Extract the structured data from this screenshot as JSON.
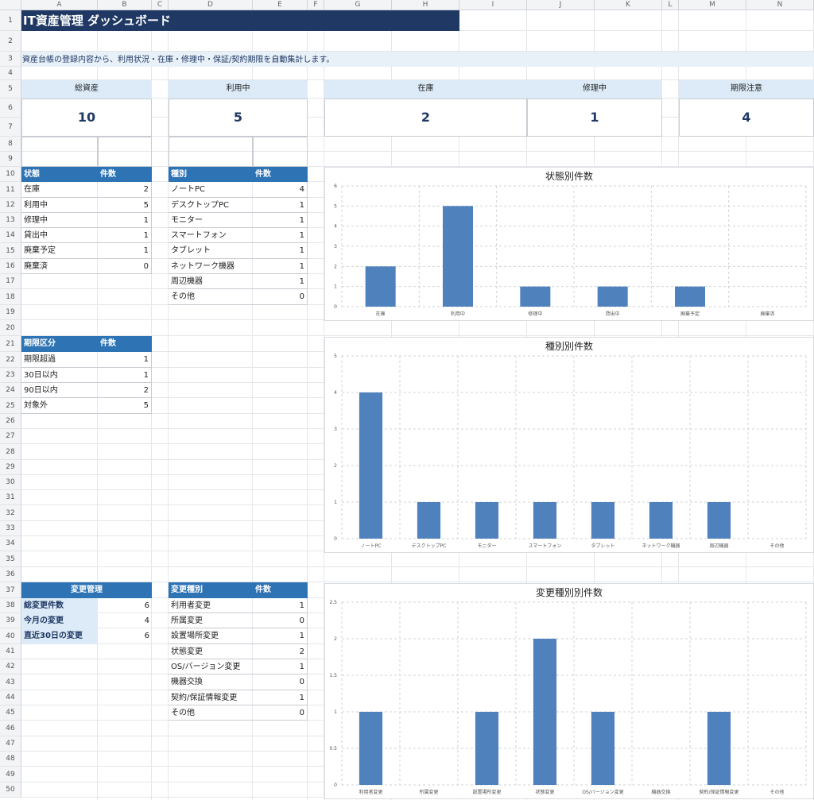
{
  "sheet": {
    "columns": [
      "A",
      "B",
      "C",
      "D",
      "E",
      "F",
      "G",
      "H",
      "I",
      "J",
      "K",
      "L",
      "M",
      "N"
    ],
    "rows": [
      "1",
      "2",
      "3",
      "4",
      "5",
      "6",
      "7",
      "8",
      "9",
      "10",
      "11",
      "12",
      "13",
      "14",
      "15",
      "16",
      "17",
      "18",
      "19",
      "20",
      "21",
      "22",
      "23",
      "24",
      "25",
      "26",
      "27",
      "28",
      "29",
      "30",
      "31",
      "32",
      "33",
      "34",
      "35",
      "36",
      "37",
      "38",
      "39",
      "40",
      "41",
      "42",
      "43",
      "44",
      "45",
      "46",
      "47",
      "48",
      "49",
      "50"
    ]
  },
  "title": "IT資産管理 ダッシュボード",
  "description": "資産台帳の登録内容から、利用状況・在庫・修理中・保証/契約期限を自動集計します。",
  "kpis": [
    {
      "label": "総資産",
      "value": "10"
    },
    {
      "label": "利用中",
      "value": "5"
    },
    {
      "label": "在庫",
      "value": "2"
    },
    {
      "label": "修理中",
      "value": "1"
    },
    {
      "label": "期限注意",
      "value": "4"
    }
  ],
  "status_table": {
    "header": [
      "状態",
      "件数"
    ],
    "rows": [
      [
        "在庫",
        "2"
      ],
      [
        "利用中",
        "5"
      ],
      [
        "修理中",
        "1"
      ],
      [
        "貸出中",
        "1"
      ],
      [
        "廃棄予定",
        "1"
      ],
      [
        "廃棄済",
        "0"
      ]
    ]
  },
  "type_table": {
    "header": [
      "種別",
      "件数"
    ],
    "rows": [
      [
        "ノートPC",
        "4"
      ],
      [
        "デスクトップPC",
        "1"
      ],
      [
        "モニター",
        "1"
      ],
      [
        "スマートフォン",
        "1"
      ],
      [
        "タブレット",
        "1"
      ],
      [
        "ネットワーク機器",
        "1"
      ],
      [
        "周辺機器",
        "1"
      ],
      [
        "その他",
        "0"
      ]
    ]
  },
  "period_table": {
    "header": [
      "期限区分",
      "件数"
    ],
    "rows": [
      [
        "期限超過",
        "1"
      ],
      [
        "30日以内",
        "1"
      ],
      [
        "90日以内",
        "2"
      ],
      [
        "対象外",
        "5"
      ]
    ]
  },
  "change_mgmt": {
    "header": "変更管理",
    "rows": [
      [
        "総変更件数",
        "6"
      ],
      [
        "今月の変更",
        "4"
      ],
      [
        "直近30日の変更",
        "6"
      ]
    ]
  },
  "change_type_table": {
    "header": [
      "変更種別",
      "件数"
    ],
    "rows": [
      [
        "利用者変更",
        "1"
      ],
      [
        "所属変更",
        "0"
      ],
      [
        "設置場所変更",
        "1"
      ],
      [
        "状態変更",
        "2"
      ],
      [
        "OS/バージョン変更",
        "1"
      ],
      [
        "機器交換",
        "0"
      ],
      [
        "契約/保証情報変更",
        "1"
      ],
      [
        "その他",
        "0"
      ]
    ]
  },
  "chart_data": [
    {
      "type": "bar",
      "title": "状態別件数",
      "categories": [
        "在庫",
        "利用中",
        "修理中",
        "貸出中",
        "廃棄予定",
        "廃棄済"
      ],
      "values": [
        2,
        5,
        1,
        1,
        1,
        0
      ],
      "ylim": [
        0,
        6
      ],
      "yticks": [
        0,
        1,
        2,
        3,
        4,
        5,
        6
      ],
      "grid": true,
      "color": "#4f81bd"
    },
    {
      "type": "bar",
      "title": "種別別件数",
      "categories": [
        "ノートPC",
        "デスクトップPC",
        "モニター",
        "スマートフォン",
        "タブレット",
        "ネットワーク機器",
        "周辺機器",
        "その他"
      ],
      "values": [
        4,
        1,
        1,
        1,
        1,
        1,
        1,
        0
      ],
      "ylim": [
        0,
        5
      ],
      "yticks": [
        0,
        1,
        2,
        3,
        4,
        5
      ],
      "grid": true,
      "color": "#4f81bd"
    },
    {
      "type": "bar",
      "title": "変更種別別件数",
      "categories": [
        "利用者変更",
        "所属変更",
        "設置場所変更",
        "状態変更",
        "OS/バージョン変更",
        "機器交換",
        "契約/保証情報変更",
        "その他"
      ],
      "values": [
        1,
        0,
        1,
        2,
        1,
        0,
        1,
        0
      ],
      "ylim": [
        0,
        2.5
      ],
      "yticks": [
        0,
        0.5,
        1,
        1.5,
        2,
        2.5
      ],
      "grid": true,
      "color": "#4f81bd"
    }
  ]
}
